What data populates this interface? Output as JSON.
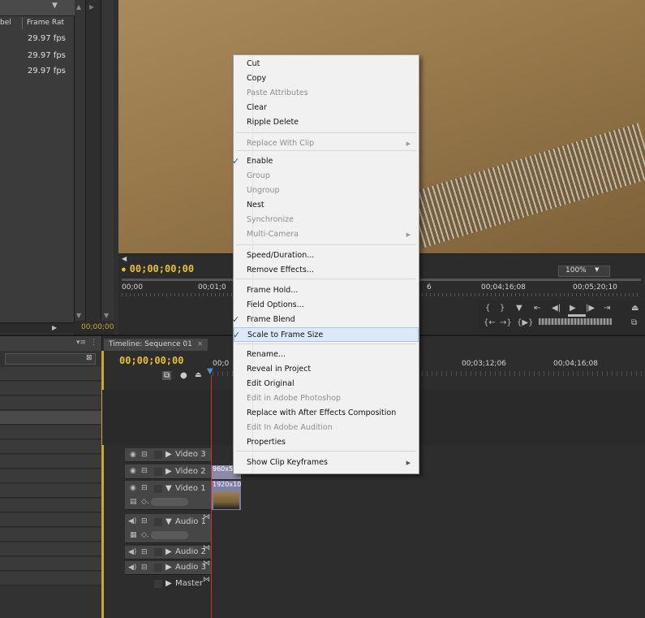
{
  "project_panel": {
    "col_label_partial": "bel",
    "col_frame_rate": "Frame Rat",
    "rows": [
      "29.97 fps",
      "29.97 fps",
      "29.97 fps"
    ]
  },
  "source_narrow": {
    "timecode": "00;00;00"
  },
  "monitor": {
    "timecode": "00;00;00;00",
    "zoom": "100%",
    "ruler_ticks": [
      "00;00",
      "00;01;0",
      "6",
      "00;04;16;08",
      "00;05;20;10"
    ]
  },
  "timeline": {
    "tab_label": "Timeline: Sequence 01",
    "timecode": "00;00;00;00",
    "ruler_ticks": [
      "00;0",
      "00;03;12;06",
      "00;04;16;08"
    ],
    "tracks": [
      {
        "name": "Video 3"
      },
      {
        "name": "Video 2"
      },
      {
        "name": "Video 1"
      },
      {
        "name": "Audio 1"
      },
      {
        "name": "Audio 2"
      },
      {
        "name": "Audio 3"
      },
      {
        "name": "Master"
      }
    ],
    "clip_v2_label": "960x540",
    "clip_v1_label": "1920x10"
  },
  "context_menu": {
    "items": [
      {
        "label": "Cut",
        "disabled": false
      },
      {
        "label": "Copy",
        "disabled": false
      },
      {
        "label": "Paste Attributes",
        "disabled": true
      },
      {
        "label": "Clear",
        "disabled": false
      },
      {
        "label": "Ripple Delete",
        "disabled": false
      },
      {
        "label": "Replace With Clip",
        "disabled": true,
        "submenu": true
      },
      {
        "label": "Enable",
        "disabled": false,
        "checked": true
      },
      {
        "label": "Group",
        "disabled": true
      },
      {
        "label": "Ungroup",
        "disabled": true
      },
      {
        "label": "Nest",
        "disabled": false
      },
      {
        "label": "Synchronize",
        "disabled": true
      },
      {
        "label": "Multi-Camera",
        "disabled": true,
        "submenu": true
      },
      {
        "label": "Speed/Duration...",
        "disabled": false
      },
      {
        "label": "Remove Effects...",
        "disabled": false
      },
      {
        "label": "Frame Hold...",
        "disabled": false
      },
      {
        "label": "Field Options...",
        "disabled": false
      },
      {
        "label": "Frame Blend",
        "disabled": false,
        "checked": true
      },
      {
        "label": "Scale to Frame Size",
        "disabled": false,
        "checked": true,
        "highlighted": true
      },
      {
        "label": "Rename...",
        "disabled": false
      },
      {
        "label": "Reveal in Project",
        "disabled": false
      },
      {
        "label": "Edit Original",
        "disabled": false
      },
      {
        "label": "Edit in Adobe Photoshop",
        "disabled": true
      },
      {
        "label": "Replace with After Effects Composition",
        "disabled": false
      },
      {
        "label": "Edit In Adobe Audition",
        "disabled": true
      },
      {
        "label": "Properties",
        "disabled": false
      },
      {
        "label": "Show Clip Keyframes",
        "disabled": false,
        "submenu": true
      }
    ]
  },
  "colors": {
    "timecode": "#e8c033",
    "playhead": "#d03030",
    "menu_bg": "#f1f1f1",
    "menu_highlight": "#dce9f7"
  }
}
